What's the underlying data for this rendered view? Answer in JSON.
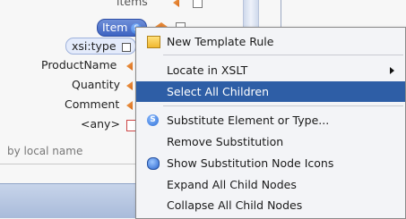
{
  "tree": {
    "items_partial": "items",
    "item_label": "Item",
    "xsi_label": "xsi:type",
    "rows": [
      {
        "label": "ProductName"
      },
      {
        "label": "Quantity"
      },
      {
        "label": "Comment"
      },
      {
        "label": "<any>"
      }
    ]
  },
  "filter": {
    "placeholder": "by local name"
  },
  "menu": {
    "items": [
      {
        "label": "New Template Rule",
        "icon": "template-rule-icon"
      },
      {
        "label": "Locate in XSLT",
        "icon": "",
        "submenu": true
      },
      {
        "label": "Select All Children",
        "icon": "",
        "selected": true
      },
      {
        "label": "Substitute Element or Type...",
        "icon": "substitute-icon"
      },
      {
        "label": "Remove Substitution",
        "icon": ""
      },
      {
        "label": "Show Substitution Node Icons",
        "icon": "radio-selected-icon"
      },
      {
        "label": "Expand All Child Nodes",
        "icon": ""
      },
      {
        "label": "Collapse All Child Nodes",
        "icon": ""
      }
    ]
  },
  "colors": {
    "selection": "#2e5ea6",
    "menu_bg": "#f3f4f7"
  }
}
